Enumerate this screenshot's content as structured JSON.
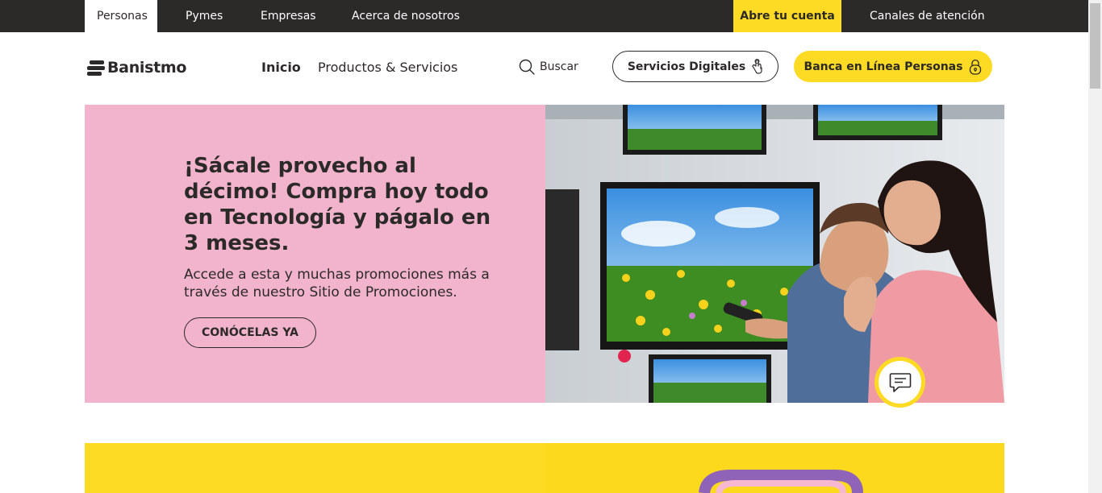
{
  "topbar": {
    "tabs": [
      "Personas",
      "Pymes",
      "Empresas",
      "Acerca de nosotros"
    ],
    "cta": "Abre tu cuenta",
    "channels": "Canales de atención"
  },
  "header": {
    "logo_text": "Banistmo",
    "nav": [
      "Inicio",
      "Productos & Servicios"
    ],
    "search_label": "Buscar",
    "digital_services": "Servicios Digitales",
    "online_banking": "Banca en Línea Personas"
  },
  "hero": {
    "title": "¡Sácale provecho al décimo! Compra hoy todo en Tecnología y págalo en 3 meses.",
    "subtitle": "Accede a esta y muchas promociones más a través de nuestro Sitio de Promociones.",
    "button": "CONÓCELAS YA"
  },
  "colors": {
    "brand_yellow": "#fdda24",
    "dark": "#2c2a29",
    "hero_pink": "#f2b3cd"
  },
  "icons": [
    "search-icon",
    "touch-icon",
    "lock-icon",
    "chat-icon",
    "logo-icon"
  ]
}
